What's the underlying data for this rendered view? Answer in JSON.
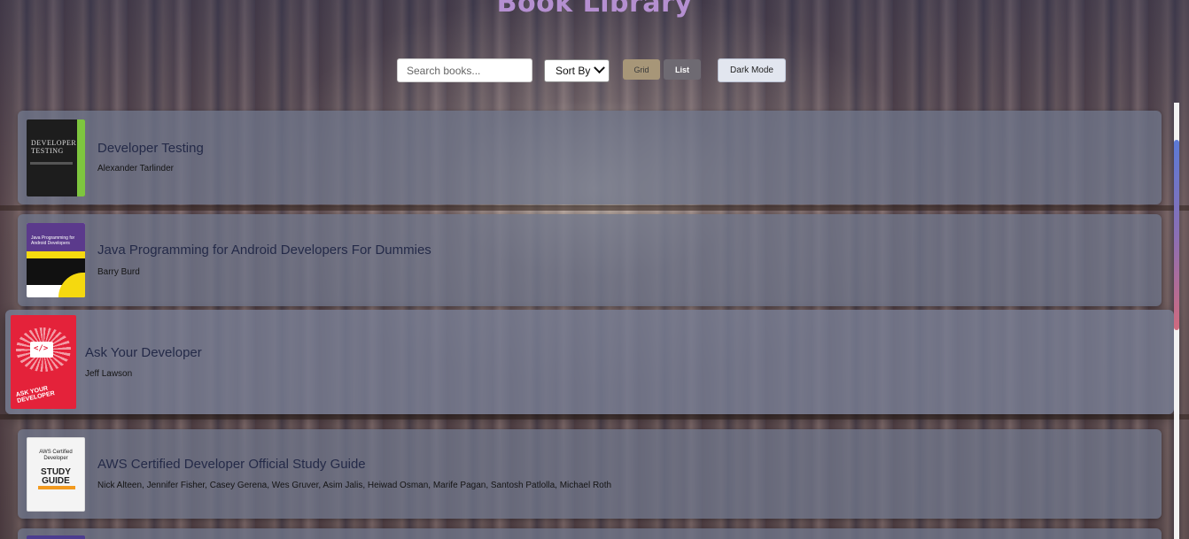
{
  "app": {
    "title": "Book Library"
  },
  "toolbar": {
    "search_placeholder": "Search books...",
    "search_value": "",
    "sort_label": "Sort By",
    "grid_label": "Grid",
    "list_label": "List",
    "dark_mode_label": "Dark Mode"
  },
  "books": [
    {
      "title": "Developer Testing",
      "author": "Alexander Tarlinder",
      "cover": {
        "line1": "DEVELOPER",
        "line2": "TESTING"
      }
    },
    {
      "title": "Java Programming for Android Developers For Dummies",
      "author": "Barry Burd",
      "cover": {
        "text": "Java Programming for Android Developers"
      }
    },
    {
      "title": "Ask Your Developer",
      "author": "Jeff Lawson",
      "cover": {
        "mark": "</>",
        "text": "ASK YOUR DEVELOPER"
      }
    },
    {
      "title": "AWS Certified Developer Official Study Guide",
      "author": "Nick Alteen, Jennifer Fisher, Casey Gerena, Wes Gruver, Asim Jalis, Heiwad Osman, Marife Pagan, Santosh Patlolla, Michael Roth",
      "cover": {
        "line1": "AWS Certified Developer",
        "line2": "STUDY GUIDE"
      }
    }
  ],
  "colors": {
    "title": "#b48fd0",
    "grid_button": "#a79678",
    "list_button": "#6e6a72",
    "dark_mode_button": "#e2e6ef",
    "card_background": "#70768a"
  }
}
